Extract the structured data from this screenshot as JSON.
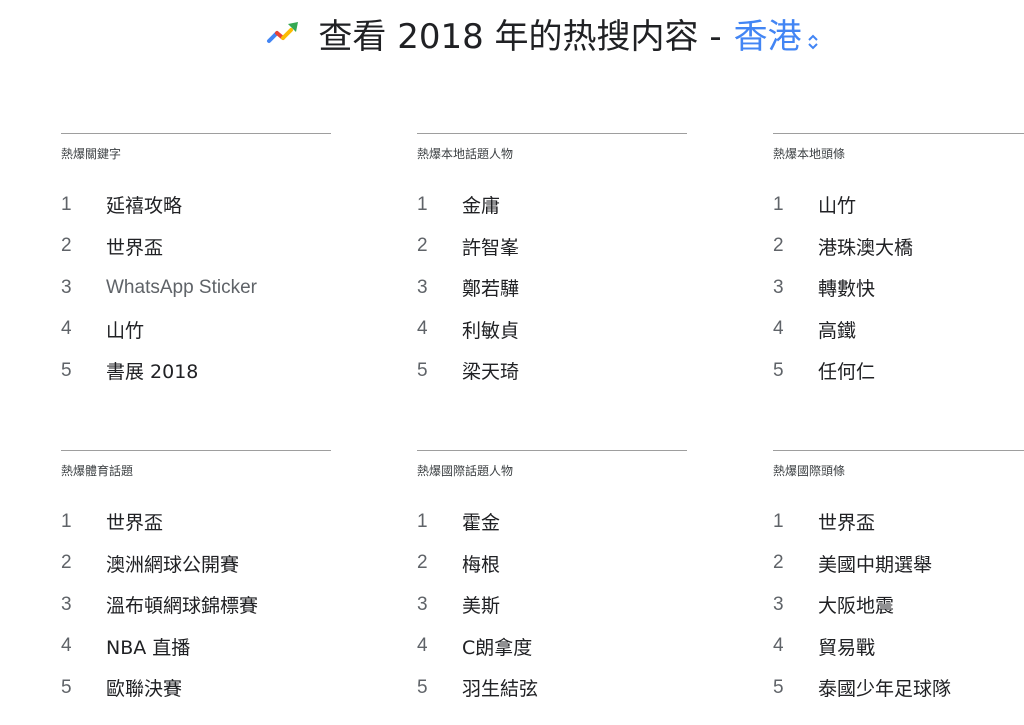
{
  "header": {
    "title": "查看 2018 年的热搜内容 - ",
    "region": "香港",
    "trend_icon": "trending-up-icon",
    "region_selector_icon": "unfold-more-icon",
    "colors": {
      "accent": "#4285f4",
      "icon_blue": "#4285f4",
      "icon_red": "#ea4335",
      "icon_yellow": "#fbbc04",
      "icon_green": "#34a853"
    }
  },
  "sections": [
    {
      "title": "熱爆關鍵字",
      "items": [
        {
          "rank": "1",
          "term": "延禧攻略"
        },
        {
          "rank": "2",
          "term": "世界盃"
        },
        {
          "rank": "3",
          "term": "WhatsApp Sticker"
        },
        {
          "rank": "4",
          "term": "山竹"
        },
        {
          "rank": "5",
          "term": "書展 2018"
        }
      ]
    },
    {
      "title": "熱爆本地話題人物",
      "items": [
        {
          "rank": "1",
          "term": "金庸"
        },
        {
          "rank": "2",
          "term": "許智峯"
        },
        {
          "rank": "3",
          "term": "鄭若驊"
        },
        {
          "rank": "4",
          "term": "利敏貞"
        },
        {
          "rank": "5",
          "term": "梁天琦"
        }
      ]
    },
    {
      "title": "熱爆本地頭條",
      "items": [
        {
          "rank": "1",
          "term": "山竹"
        },
        {
          "rank": "2",
          "term": "港珠澳大橋"
        },
        {
          "rank": "3",
          "term": "轉數快"
        },
        {
          "rank": "4",
          "term": "高鐵"
        },
        {
          "rank": "5",
          "term": "任何仁"
        }
      ]
    },
    {
      "title": "熱爆體育話題",
      "items": [
        {
          "rank": "1",
          "term": "世界盃"
        },
        {
          "rank": "2",
          "term": "澳洲網球公開賽"
        },
        {
          "rank": "3",
          "term": "溫布頓網球錦標賽"
        },
        {
          "rank": "4",
          "term": "NBA 直播"
        },
        {
          "rank": "5",
          "term": "歐聯決賽"
        }
      ]
    },
    {
      "title": "熱爆國際話題人物",
      "items": [
        {
          "rank": "1",
          "term": "霍金"
        },
        {
          "rank": "2",
          "term": "梅根"
        },
        {
          "rank": "3",
          "term": "美斯"
        },
        {
          "rank": "4",
          "term": "C朗拿度"
        },
        {
          "rank": "5",
          "term": "羽生結弦"
        }
      ]
    },
    {
      "title": "熱爆國際頭條",
      "items": [
        {
          "rank": "1",
          "term": "世界盃"
        },
        {
          "rank": "2",
          "term": "美國中期選舉"
        },
        {
          "rank": "3",
          "term": "大阪地震"
        },
        {
          "rank": "4",
          "term": "貿易戰"
        },
        {
          "rank": "5",
          "term": "泰國少年足球隊"
        }
      ]
    }
  ]
}
